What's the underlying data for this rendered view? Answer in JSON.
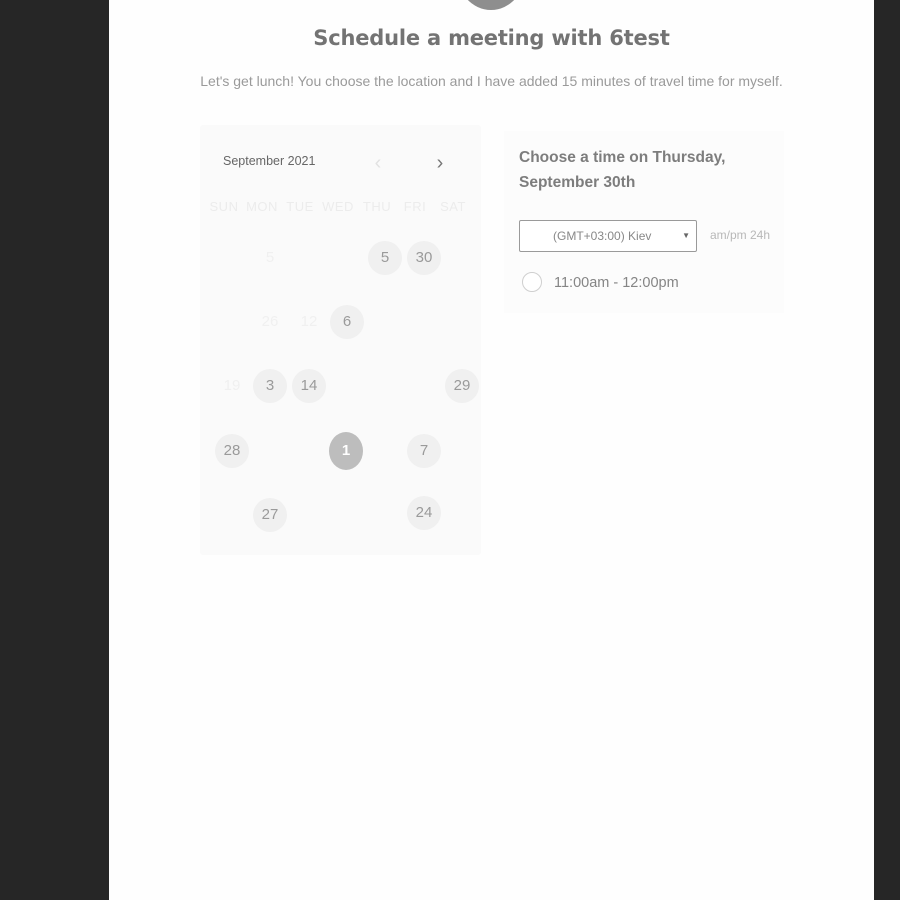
{
  "header": {
    "title": "Schedule a meeting with 6test",
    "description": "Let's get lunch! You choose the location and I have added 15 minutes of travel time for myself."
  },
  "calendar": {
    "month_label": "September 2021",
    "prev_icon": "chevron-left-icon",
    "next_icon": "chevron-right-icon",
    "weekdays": [
      "SUN",
      "MON",
      "TUE",
      "WED",
      "THU",
      "FRI",
      "SAT"
    ],
    "days": [
      {
        "label": "5",
        "state": "faded"
      },
      {
        "label": "5",
        "state": "available"
      },
      {
        "label": "30",
        "state": "available"
      },
      {
        "label": "26",
        "state": "faded"
      },
      {
        "label": "12",
        "state": "faded"
      },
      {
        "label": "6",
        "state": "available"
      },
      {
        "label": "19",
        "state": "faded"
      },
      {
        "label": "3",
        "state": "available"
      },
      {
        "label": "14",
        "state": "available"
      },
      {
        "label": "29",
        "state": "available"
      },
      {
        "label": "28",
        "state": "available"
      },
      {
        "label": "1",
        "state": "selected"
      },
      {
        "label": "7",
        "state": "available"
      },
      {
        "label": "27",
        "state": "available"
      },
      {
        "label": "24",
        "state": "available"
      }
    ]
  },
  "times": {
    "heading": "Choose a time on Thursday, September 30th",
    "timezone": "(GMT+03:00) Kiev",
    "format_toggle": "am/pm  24h",
    "slots": [
      {
        "label": "11:00am - 12:00pm"
      }
    ]
  }
}
